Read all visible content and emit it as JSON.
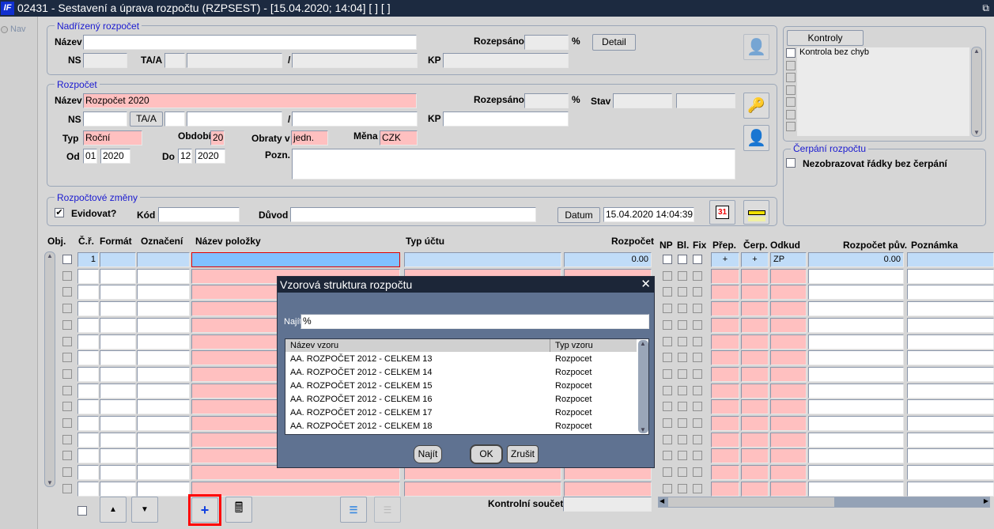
{
  "window": {
    "title": "02431 - Sestavení a úprava rozpočtu (RZPSEST) - [15.04.2020; 14:04]  [ ]  [ ]",
    "logo": "IF",
    "nav_label": "Nav"
  },
  "parent_budget": {
    "group_title": "Nadřízený rozpočet",
    "name_label": "Název",
    "name_value": "",
    "rozepsano_label": "Rozepsáno",
    "rozepsano_value": "",
    "percent": "%",
    "detail_button": "Detail",
    "ns_label": "NS",
    "taa_label": "TA/A",
    "slash": "/",
    "kp_label": "KP"
  },
  "budget": {
    "group_title": "Rozpočet",
    "name_label": "Název",
    "name_value": "Rozpočet 2020",
    "rozepsano_label": "Rozepsáno",
    "percent": "%",
    "stav_label": "Stav",
    "ns_label": "NS",
    "taa_button": "TA/A",
    "slash": "/",
    "kp_label": "KP",
    "typ_label": "Typ",
    "typ_value": "Roční",
    "obdobi_label": "Období",
    "obdobi_value": "20",
    "obraty_label": "Obraty v",
    "obraty_value": "jedn.",
    "mena_label": "Měna",
    "mena_value": "CZK",
    "od_label": "Od",
    "od_month": "01",
    "od_year": "2020",
    "do_label": "Do",
    "do_month": "12",
    "do_year": "2020",
    "pozn_label": "Pozn.",
    "pozn_value": ""
  },
  "changes": {
    "group_title": "Rozpočtové změny",
    "evidovat_label": "Evidovat?",
    "evidovat_checked": true,
    "kod_label": "Kód",
    "kod_value": "",
    "duvod_label": "Důvod",
    "duvod_value": "",
    "datum_button": "Datum",
    "datum_value": "15.04.2020 14:04:39"
  },
  "checks": {
    "button": "Kontroly",
    "items": [
      "Kontrola bez chyb",
      "",
      "",
      "",
      "",
      "",
      ""
    ]
  },
  "cerpani": {
    "group_title": "Čerpání rozpočtu",
    "option_label": "Nezobrazovat řádky bez čerpání",
    "checked": false
  },
  "grid": {
    "columns": {
      "obj": "Obj.",
      "cr": "Č.ř.",
      "format": "Formát",
      "oznaceni": "Označení",
      "nazev": "Název položky",
      "typ_uctu": "Typ účtu",
      "rozpocet": "Rozpočet",
      "np": "NP",
      "bl": "Bl.",
      "fix": "Fix",
      "prep": "Přep.",
      "cerp": "Čerp.",
      "odkud": "Odkud",
      "rozpocet_puv": "Rozpočet pův.",
      "poznamka": "Poznámka"
    },
    "rows": [
      {
        "cr": "1",
        "format": "",
        "oznaceni": "",
        "nazev": "",
        "typ_uctu": "",
        "rozpocet": "0.00",
        "prep": "+",
        "cerp": "+",
        "odkud": "ZP",
        "rozpocet_puv": "0.00",
        "poznamka": ""
      },
      {},
      {},
      {},
      {},
      {},
      {},
      {},
      {},
      {},
      {},
      {},
      {},
      {},
      {}
    ]
  },
  "footer": {
    "kontrolni_label": "Kontrolní součet",
    "kontrolni_value": ""
  },
  "dialog": {
    "title": "Vzorová struktura rozpočtu",
    "najit_label": "Najít",
    "najit_value": "%",
    "col_name": "Název vzoru",
    "col_type": "Typ vzoru",
    "items": [
      {
        "name": "AA. ROZPOČET 2012 - CELKEM 13",
        "type": "Rozpocet"
      },
      {
        "name": "AA. ROZPOČET 2012 - CELKEM 14",
        "type": "Rozpocet"
      },
      {
        "name": "AA. ROZPOČET 2012 - CELKEM 15",
        "type": "Rozpocet"
      },
      {
        "name": "AA. ROZPOČET 2012 - CELKEM 16",
        "type": "Rozpocet"
      },
      {
        "name": "AA. ROZPOČET 2012 - CELKEM 17",
        "type": "Rozpocet"
      },
      {
        "name": "AA. ROZPOČET 2012 - CELKEM 18",
        "type": "Rozpocet"
      }
    ],
    "najit_button": "Najít",
    "ok_button": "OK",
    "cancel_button": "Zrušit"
  },
  "colors": {
    "pink": "#ffc0c0",
    "light_blue": "#c0dcf8",
    "active": "#80c0ff",
    "highlight": "#ff0000",
    "title_bar": "#1c2a40",
    "dialog": "#5f7291"
  }
}
